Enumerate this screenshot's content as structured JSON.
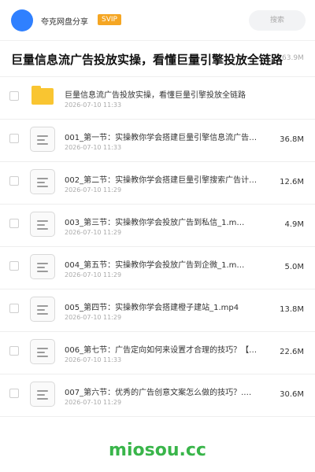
{
  "header": {
    "app_name": "夸克网盘分享",
    "badge": "SVIP",
    "search_placeholder": "搜索"
  },
  "share": {
    "title": "巨量信息流广告投放实操，看懂巨量引擎投放全链路",
    "total_size": "63.9M"
  },
  "files": [
    {
      "type": "folder",
      "name": "巨量信息流广告投放实操，看懂巨量引擎投放全链路",
      "date": "2026-07-10 11:33",
      "size": ""
    },
    {
      "type": "doc",
      "name": "001_第一节：实操教你学会搭建巨量引擎信息流广告…",
      "date": "2026-07-10 11:33",
      "size": "36.8M"
    },
    {
      "type": "doc",
      "name": "002_第二节：实操教你学会搭建巨量引擎搜索广告计…",
      "date": "2026-07-10 11:29",
      "size": "12.6M"
    },
    {
      "type": "doc",
      "name": "003_第三节：实操教你学会投放广告到私信_1.m…",
      "date": "2026-07-10 11:29",
      "size": "4.9M"
    },
    {
      "type": "doc",
      "name": "004_第五节：实操教你学会投放广告到企微_1.m…",
      "date": "2026-07-10 11:29",
      "size": "5.0M"
    },
    {
      "type": "doc",
      "name": "005_第四节：实操教你学会搭建橙子建站_1.mp4",
      "date": "2026-07-10 11:29",
      "size": "13.8M"
    },
    {
      "type": "doc",
      "name": "006_第七节：广告定向如何来设置才合理的技巧？【…",
      "date": "2026-07-10 11:33",
      "size": "22.6M"
    },
    {
      "type": "doc",
      "name": "007_第六节：优秀的广告创意文案怎么做的技巧？.…",
      "date": "2026-07-10 11:29",
      "size": "30.6M"
    }
  ],
  "watermark": "miosou.cc",
  "colors": {
    "accent": "#2f80ff",
    "svip": "#f5a623",
    "folder": "#f9c531",
    "watermark": "#39b54a"
  }
}
